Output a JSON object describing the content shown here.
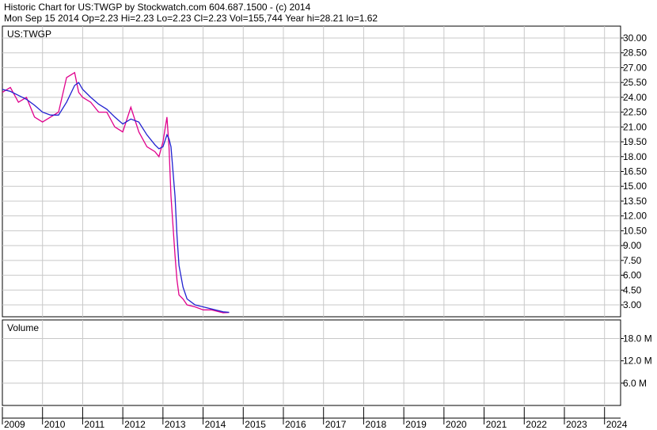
{
  "header": {
    "line1": "Historic Chart for US:TWGP by Stockwatch.com 604.687.1500 - (c) 2014",
    "line2": "Mon Sep 15 2014   Op=2.23   Hi=2.23   Lo=2.23   Cl=2.23   Vol=155,744   Year hi=28.21   lo=1.62"
  },
  "chart_data": [
    {
      "type": "line",
      "title": "US:TWGP",
      "ylim": [
        1.8,
        31.2
      ],
      "yticks": [
        "30.00",
        "28.50",
        "27.00",
        "25.50",
        "24.00",
        "22.50",
        "21.00",
        "19.50",
        "18.00",
        "16.50",
        "15.00",
        "13.50",
        "12.00",
        "10.50",
        "9.00",
        "7.50",
        "6.00",
        "4.50",
        "3.00"
      ],
      "xlim": [
        2009.0,
        2024.4
      ],
      "xticks": [
        "2009",
        "2010",
        "2011",
        "2012",
        "2013",
        "2014",
        "2015",
        "2016",
        "2017",
        "2018",
        "2019",
        "2020",
        "2021",
        "2022",
        "2023",
        "2024"
      ],
      "grid": true,
      "x": [
        2009.0,
        2009.2,
        2009.4,
        2009.6,
        2009.8,
        2010.0,
        2010.2,
        2010.4,
        2010.6,
        2010.8,
        2010.9,
        2011.0,
        2011.2,
        2011.4,
        2011.6,
        2011.8,
        2012.0,
        2012.2,
        2012.4,
        2012.6,
        2012.8,
        2012.9,
        2013.0,
        2013.1,
        2013.15,
        2013.2,
        2013.3,
        2013.35,
        2013.4,
        2013.5,
        2013.6,
        2013.8,
        2014.0,
        2014.2,
        2014.4,
        2014.5,
        2014.65
      ],
      "series": [
        {
          "values": [
            24.5,
            25.0,
            23.5,
            24.0,
            22.0,
            21.5,
            22.0,
            22.5,
            26.0,
            26.5,
            24.5,
            24.0,
            23.5,
            22.5,
            22.5,
            21.0,
            20.5,
            23.0,
            20.5,
            19.0,
            18.5,
            18.0,
            19.5,
            22.0,
            19.0,
            14.0,
            8.0,
            5.5,
            4.0,
            3.6,
            3.0,
            2.8,
            2.5,
            2.5,
            2.3,
            2.2,
            2.23
          ]
        },
        {
          "values": [
            24.8,
            24.6,
            24.2,
            23.8,
            23.2,
            22.5,
            22.2,
            22.2,
            23.5,
            25.2,
            25.5,
            24.8,
            24.0,
            23.3,
            22.8,
            22.0,
            21.3,
            21.8,
            21.5,
            20.2,
            19.2,
            18.8,
            19.0,
            20.2,
            19.8,
            19.0,
            14.0,
            10.0,
            7.0,
            4.8,
            3.6,
            3.0,
            2.8,
            2.6,
            2.4,
            2.3,
            2.25
          ]
        }
      ]
    },
    {
      "type": "bar",
      "title": "Volume",
      "ylim": [
        0,
        23
      ],
      "yticks": [
        "18.0 M",
        "12.0 M",
        "6.0 M"
      ]
    }
  ]
}
